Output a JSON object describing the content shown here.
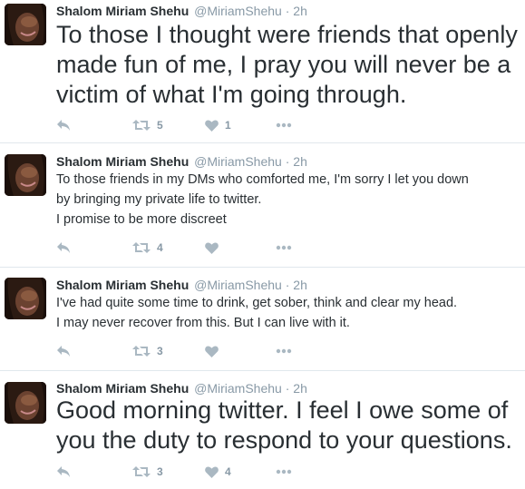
{
  "colors": {
    "text": "#292f33",
    "muted": "#8899a6",
    "divider": "#e1e8ed",
    "icon": "#aab8c2"
  },
  "tweets": [
    {
      "author_name": "Shalom Miriam Shehu",
      "handle": "@MiriamShehu",
      "separator": "·",
      "time": "2h",
      "text_size": "large",
      "lines": [
        "To those I thought were friends that openly",
        "made fun of me, I pray you will never be a",
        "victim of what I'm going through."
      ],
      "retweets": "5",
      "likes": "1"
    },
    {
      "author_name": "Shalom Miriam Shehu",
      "handle": "@MiriamShehu",
      "separator": "·",
      "time": "2h",
      "text_size": "small",
      "lines": [
        "To those friends in my DMs who comforted me, I'm sorry I let you down",
        "by bringing my private life to twitter.",
        "I promise to be more discreet"
      ],
      "retweets": "4",
      "likes": ""
    },
    {
      "author_name": "Shalom Miriam Shehu",
      "handle": "@MiriamShehu",
      "separator": "·",
      "time": "2h",
      "text_size": "small",
      "lines": [
        "I've had quite some time to drink, get sober, think and clear my head.",
        "I may never recover from this. But I can live with it."
      ],
      "retweets": "3",
      "likes": ""
    },
    {
      "author_name": "Shalom Miriam Shehu",
      "handle": "@MiriamShehu",
      "separator": "·",
      "time": "2h",
      "text_size": "large",
      "lines": [
        "Good morning twitter. I feel I owe some of",
        "you the duty to respond to your questions."
      ],
      "retweets": "3",
      "likes": "4"
    }
  ],
  "icons": {
    "reply": "reply-icon",
    "retweet": "retweet-icon",
    "like": "heart-icon",
    "more": "more-icon",
    "avatar": "profile-avatar"
  }
}
